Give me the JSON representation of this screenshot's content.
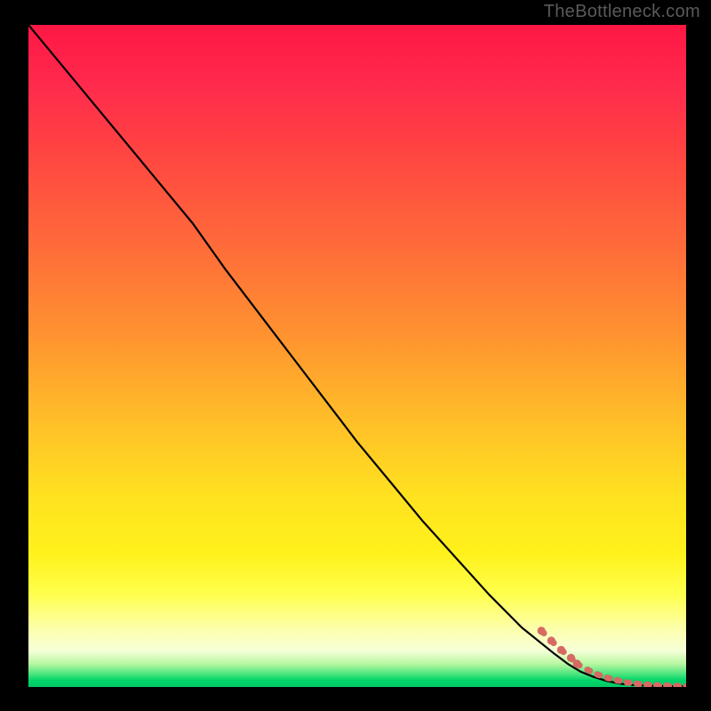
{
  "watermark": "TheBottleneck.com",
  "colors": {
    "background_frame": "#000000",
    "gradient_top": "#ff1744",
    "gradient_mid1": "#ff9330",
    "gradient_mid2": "#ffe120",
    "gradient_pale": "#fdffa8",
    "gradient_green": "#00d66a",
    "curve": "#000000",
    "marker": "#d66a62"
  },
  "chart_data": {
    "type": "line",
    "title": "",
    "xlabel": "",
    "ylabel": "",
    "xlim": [
      0,
      100
    ],
    "ylim": [
      0,
      100
    ],
    "grid": false,
    "legend": false,
    "series": [
      {
        "name": "bottleneck-curve",
        "style": "solid",
        "color": "#000000",
        "x": [
          0,
          5,
          10,
          15,
          20,
          25,
          30,
          35,
          40,
          45,
          50,
          55,
          60,
          65,
          70,
          75,
          80,
          82,
          84,
          86,
          88,
          90,
          92,
          94,
          96,
          98,
          100
        ],
        "y": [
          100,
          94,
          88,
          82,
          76,
          70,
          63,
          56.5,
          50,
          43.5,
          37,
          31,
          25,
          19.5,
          14,
          9,
          5,
          3.5,
          2.3,
          1.5,
          0.9,
          0.5,
          0.3,
          0.2,
          0.15,
          0.1,
          0.1
        ]
      },
      {
        "name": "optimal-zone-markers",
        "style": "dashed-markers",
        "color": "#d66a62",
        "x": [
          78,
          79.5,
          81,
          82.5,
          83.4,
          85,
          86.5,
          88,
          89.5,
          91,
          92.5,
          94,
          95.5,
          97,
          98.5,
          100
        ],
        "y": [
          8.5,
          7,
          5.6,
          4.4,
          3.5,
          2.6,
          1.9,
          1.4,
          1.0,
          0.7,
          0.5,
          0.35,
          0.25,
          0.2,
          0.15,
          0.1
        ]
      }
    ]
  }
}
